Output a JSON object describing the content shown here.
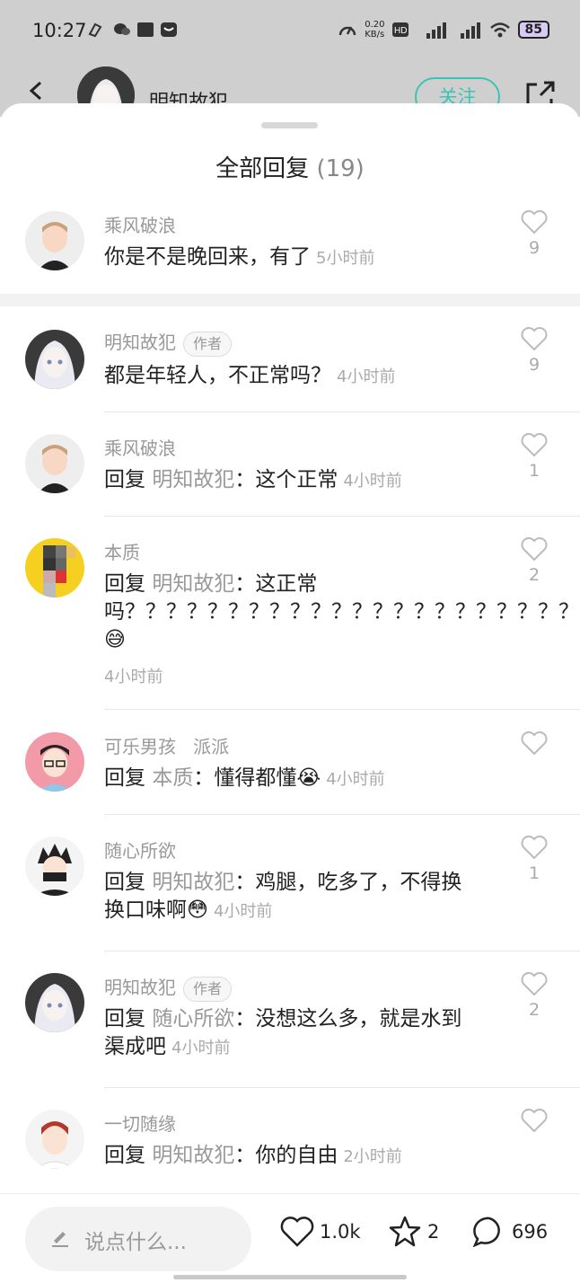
{
  "status_bar": {
    "time": "10:27",
    "net_speed": "0.20\nKB/s",
    "battery": "85",
    "signal1": "5G",
    "signal2": "5G"
  },
  "header": {
    "user_name": "明知故犯",
    "follow_label": "关注"
  },
  "sheet": {
    "title": "全部回复",
    "count": "(19)"
  },
  "top_comment": {
    "user": "乘风破浪",
    "text": "你是不是晚回来，有了",
    "time": "5小时前",
    "likes": "9"
  },
  "replies": [
    {
      "user": "明知故犯",
      "tag": "作者",
      "ref": "",
      "text": "都是年轻人，不正常吗？",
      "time": "4小时前",
      "likes": "9"
    },
    {
      "user": "乘风破浪",
      "tag": "",
      "prefix": "回复",
      "ref": "明知故犯",
      "text": "：这个正常",
      "time": "4小时前",
      "likes": "1"
    },
    {
      "user": "本质",
      "tag": "",
      "prefix": "回复",
      "ref": "明知故犯",
      "text": "：这正常吗？？？？？？？？？？？？？？？？？？？？？？？？？？？？？？？？？？😅",
      "time": "4小时前",
      "likes": "2"
    },
    {
      "user": "可乐男孩",
      "user_extra": "派派",
      "tag": "",
      "prefix": "回复",
      "ref": "本质",
      "text": "：懂得都懂😭",
      "time": "4小时前",
      "likes": ""
    },
    {
      "user": "随心所欲",
      "tag": "",
      "prefix": "回复",
      "ref": "明知故犯",
      "text": "：鸡腿，吃多了，不得换换口味啊😳",
      "time": "4小时前",
      "likes": "1"
    },
    {
      "user": "明知故犯",
      "tag": "作者",
      "prefix": "回复",
      "ref": "随心所欲",
      "text": "：没想这么多，就是水到渠成吧",
      "time": "4小时前",
      "likes": "2"
    },
    {
      "user": "一切随缘",
      "tag": "",
      "prefix": "回复",
      "ref": "明知故犯",
      "text": "：你的自由",
      "time": "2小时前",
      "likes": ""
    }
  ],
  "bottom_bar": {
    "input_placeholder": "说点什么...",
    "likes": "1.0k",
    "favorites": "2",
    "comments": "696"
  },
  "colors": {
    "accent": "#3cc3b5",
    "muted": "#999999",
    "text": "#222222"
  }
}
